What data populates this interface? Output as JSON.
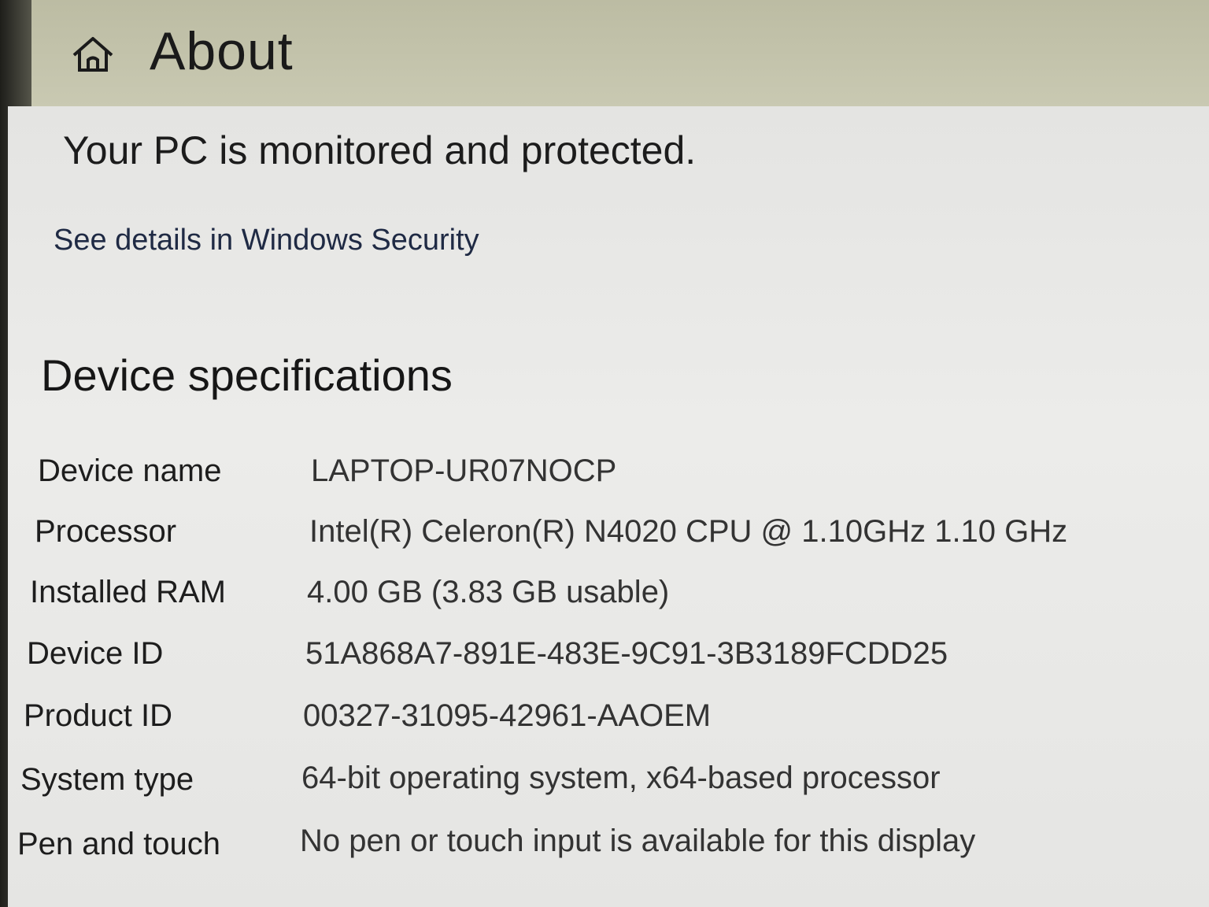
{
  "header": {
    "title": "About",
    "icon": "home-icon"
  },
  "protection": {
    "status": "Your PC is monitored and protected.",
    "link": "See details in Windows Security"
  },
  "device_specifications": {
    "heading": "Device specifications",
    "rows": [
      {
        "label": "Device name",
        "value": "LAPTOP-UR07NOCP"
      },
      {
        "label": "Processor",
        "value": "Intel(R) Celeron(R) N4020 CPU @ 1.10GHz   1.10 GHz"
      },
      {
        "label": "Installed RAM",
        "value": "4.00 GB (3.83 GB usable)"
      },
      {
        "label": "Device ID",
        "value": "51A868A7-891E-483E-9C91-3B3189FCDD25"
      },
      {
        "label": "Product ID",
        "value": "00327-31095-42961-AAOEM"
      },
      {
        "label": "System type",
        "value": "64-bit operating system, x64-based processor"
      },
      {
        "label": "Pen and touch",
        "value": "No pen or touch input is available for this display"
      }
    ]
  }
}
